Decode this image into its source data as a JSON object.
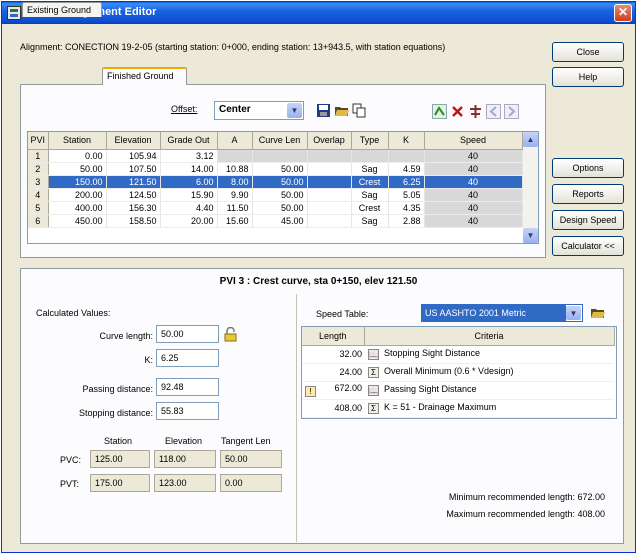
{
  "window": {
    "title": "Vertical Alignment Editor",
    "close_glyph": "✕"
  },
  "alignment_info": "Alignment:  CONECTION 19-2-05  (starting station: 0+000, ending station: 13+943.5, with station equations)",
  "side_buttons": {
    "close": "Close",
    "help": "Help",
    "options": "Options",
    "reports": "Reports",
    "design_speed": "Design Speed",
    "calculator": "Calculator <<"
  },
  "tabs": [
    "Existing Ground",
    "Finished Ground"
  ],
  "offset": {
    "label": "Offset:",
    "value": "Center"
  },
  "grid": {
    "columns": [
      "PVI",
      "Station",
      "Elevation",
      "Grade Out",
      "A",
      "Curve Len",
      "Overlap",
      "Type",
      "K",
      "Speed"
    ],
    "rows": [
      [
        "1",
        "0.00",
        "105.94",
        "3.12",
        "",
        "",
        "",
        "",
        "",
        "40"
      ],
      [
        "2",
        "50.00",
        "107.50",
        "14.00",
        "10.88",
        "50.00",
        "",
        "Sag",
        "4.59",
        "40"
      ],
      [
        "3",
        "150.00",
        "121.50",
        "6.00",
        "8.00",
        "50.00",
        "",
        "Crest",
        "6.25",
        "40"
      ],
      [
        "4",
        "200.00",
        "124.50",
        "15.90",
        "9.90",
        "50.00",
        "",
        "Sag",
        "5.05",
        "40"
      ],
      [
        "5",
        "400.00",
        "156.30",
        "4.40",
        "11.50",
        "50.00",
        "",
        "Crest",
        "4.35",
        "40"
      ],
      [
        "6",
        "450.00",
        "158.50",
        "20.00",
        "15.60",
        "45.00",
        "",
        "Sag",
        "2.88",
        "40"
      ]
    ],
    "selected_row": 2
  },
  "pvi_header": "PVI 3 :  Crest curve,  sta 0+150,  elev 121.50",
  "calc": {
    "heading": "Calculated Values:",
    "curve_length_label": "Curve length:",
    "curve_length": "50.00",
    "k_label": "K:",
    "k": "6.25",
    "passing_label": "Passing distance:",
    "passing": "92.48",
    "stopping_label": "Stopping distance:",
    "stopping": "55.83",
    "cols": [
      "Station",
      "Elevation",
      "Tangent Len"
    ],
    "pvc_label": "PVC:",
    "pvc": [
      "125.00",
      "118.00",
      "50.00"
    ],
    "pvt_label": "PVT:",
    "pvt": [
      "175.00",
      "123.00",
      "0.00"
    ]
  },
  "speed_table": {
    "label": "Speed Table:",
    "value": "US AASHTO 2001 Metric",
    "columns": [
      "Length",
      "Criteria"
    ],
    "rows": [
      {
        "length": "32.00",
        "icon": "📖",
        "criteria": "Stopping Sight Distance"
      },
      {
        "length": "24.00",
        "icon": "Σ",
        "criteria": "Overall Minimum (0.6 * Vdesign)"
      },
      {
        "length": "672.00",
        "icon": "📖",
        "criteria": "Passing Sight Distance",
        "flag": "!"
      },
      {
        "length": "408.00",
        "icon": "Σ",
        "criteria": "K = 51 - Drainage Maximum"
      }
    ],
    "min_recommended": "Minimum recommended length: 672.00",
    "max_recommended": "Maximum recommended length: 408.00"
  }
}
